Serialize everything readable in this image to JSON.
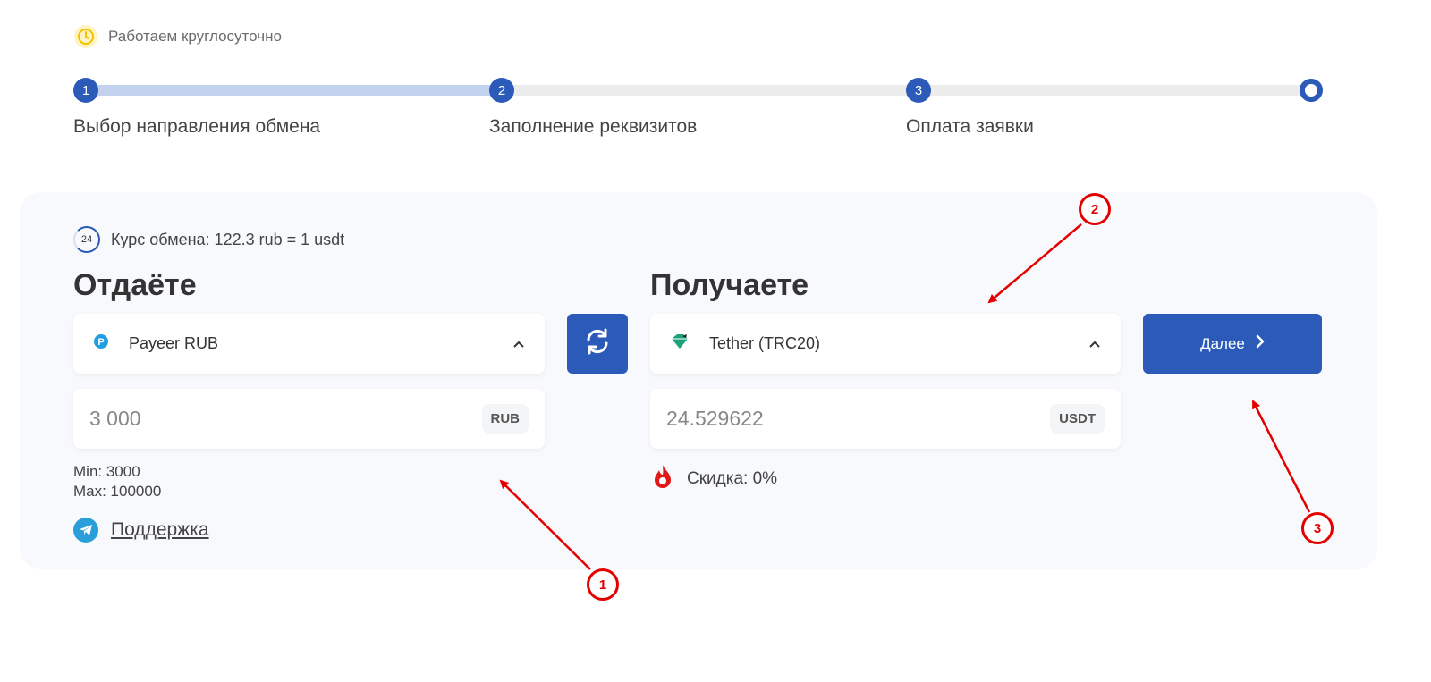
{
  "header": {
    "hours_text": "Работаем круглосуточно",
    "hours_icon": "clock-icon"
  },
  "stepper": {
    "steps": [
      {
        "number": "1",
        "label": "Выбор направления обмена"
      },
      {
        "number": "2",
        "label": "Заполнение реквизитов"
      },
      {
        "number": "3",
        "label": "Оплата заявки"
      }
    ],
    "progress": 1,
    "total_steps": 3
  },
  "exchange": {
    "rate_badge": "24",
    "rate_text": "Курс обмена: 122.3 rub = 1 usdt",
    "give": {
      "heading": "Отдаёте",
      "currency": "Payeer RUB",
      "icon": "payeer-icon",
      "amount": "3 000",
      "code": "RUB",
      "min": "Min: 3000",
      "max": "Max: 100000"
    },
    "receive": {
      "heading": "Получаете",
      "currency": "Tether (TRC20)",
      "icon": "tether-icon",
      "amount": "24.529622",
      "code": "USDT",
      "discount": "Скидка: 0%"
    },
    "next_label": "Далее",
    "support_label": "Поддержка"
  },
  "annotations": [
    "1",
    "2",
    "3"
  ],
  "colors": {
    "accent": "#2b5ab8",
    "track_done": "#c3d2ee",
    "track_todo": "#ececec",
    "annotation": "#e50000",
    "card": "#f7f9fc"
  }
}
